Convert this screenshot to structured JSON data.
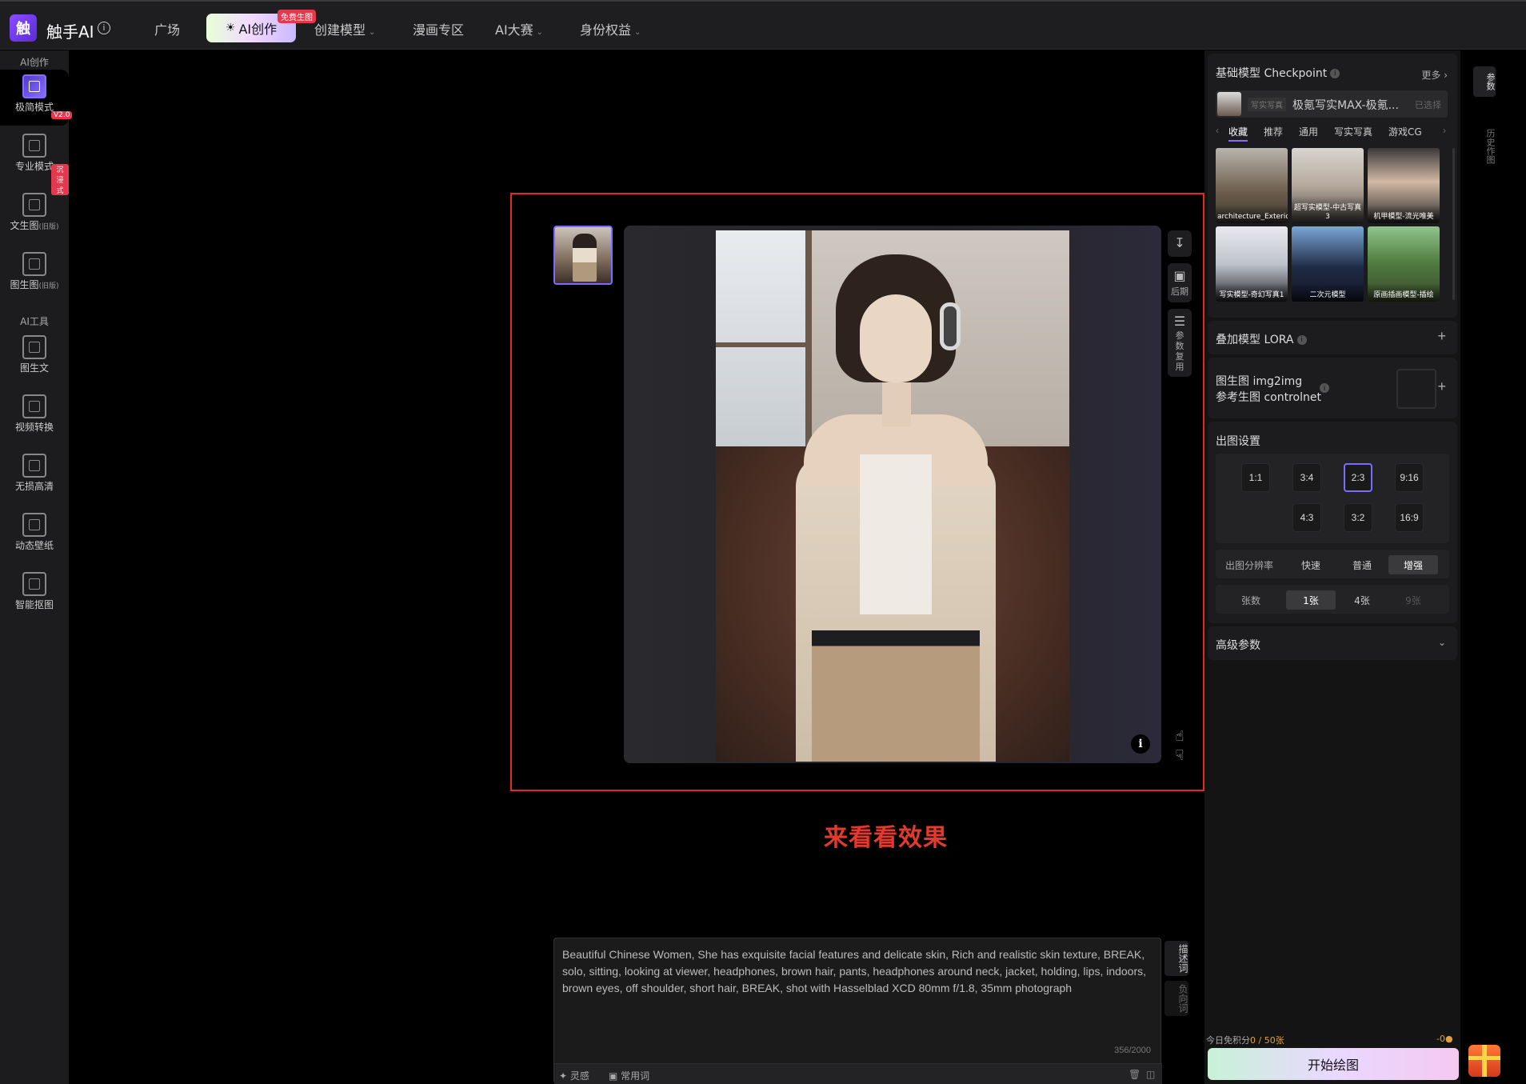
{
  "topbar": {
    "logo_text": "触",
    "app_title": "触手AI",
    "nav": [
      {
        "label": "广场"
      },
      {
        "label": "AI创作",
        "badge": "免费生图"
      },
      {
        "label": "创建模型"
      },
      {
        "label": "漫画专区"
      },
      {
        "label": "AI大赛"
      },
      {
        "label": "身份权益"
      }
    ],
    "active_icon": "bulb-icon"
  },
  "sidebar": {
    "section_create": "AI创作",
    "section_tools": "AI工具",
    "items": [
      {
        "label": "极简模式",
        "badge": "V2.0",
        "icon": "magic-wand-icon"
      },
      {
        "label": "专业模式",
        "badge": "沉浸式",
        "icon": "cursor-canvas-icon"
      },
      {
        "label": "文生图",
        "suffix": "(旧版)",
        "icon": "text-to-image-icon"
      },
      {
        "label": "图生图",
        "suffix": "(旧版)",
        "icon": "image-to-image-icon"
      },
      {
        "label": "图生文",
        "icon": "image-to-text-icon"
      },
      {
        "label": "视频转换",
        "icon": "video-convert-icon"
      },
      {
        "label": "无损高清",
        "icon": "hd-upscale-icon"
      },
      {
        "label": "动态壁纸",
        "icon": "live-wallpaper-icon"
      },
      {
        "label": "智能抠图",
        "icon": "smart-cutout-icon"
      }
    ]
  },
  "viewer": {
    "tools": [
      {
        "label": "",
        "icon": "download-icon"
      },
      {
        "label": "后期",
        "icon": "edit-image-icon"
      },
      {
        "label": "参数复用",
        "icon": "sliders-icon"
      }
    ],
    "info_glyph": "i",
    "caption": "来看看效果"
  },
  "prompt": {
    "text": "Beautiful Chinese Women,  She has exquisite facial features and delicate skin,  Rich and realistic skin texture,  BREAK,  solo,  sitting,  looking at viewer,  headphones,  brown hair,  pants,  headphones around neck,  jacket,  holding,  lips,  indoors,  brown eyes,  off shoulder,  short hair,  BREAK,  shot with Hasselblad XCD 80mm f/1.8,  35mm photograph",
    "count": "356/2000",
    "foot_inspire": "灵感",
    "foot_common": "常用词",
    "tab_positive": "描述词",
    "tab_negative": "负向词"
  },
  "rpanel": {
    "checkpoint_title": "基础模型 Checkpoint",
    "more": "更多",
    "selected_tag": "写实写真",
    "selected_name": "极氪写实MAX-极氪...",
    "selected_state": "已选择",
    "model_tabs": [
      "收藏",
      "推荐",
      "通用",
      "写实写真",
      "游戏CG"
    ],
    "models": [
      {
        "label": "architecture_Exterior"
      },
      {
        "label": "超写实模型-中古写真3"
      },
      {
        "label": "机甲模型-流光唯美"
      },
      {
        "label": "写实模型-奇幻写真1"
      },
      {
        "label": "二次元模型"
      },
      {
        "label": "原画插画模型-插绘"
      }
    ],
    "lora_title": "叠加模型 LORA",
    "img2img_line1": "图生图 img2img",
    "img2img_line2": "参考生图 controlnet",
    "output_title": "出图设置",
    "ratios": [
      "1:1",
      "3:4",
      "2:3",
      "9:16",
      "4:3",
      "3:2",
      "16:9"
    ],
    "selected_ratio": "2:3",
    "resolution_label": "出图分辨率",
    "resolution_opts": [
      "快速",
      "普通",
      "增强"
    ],
    "resolution_selected": "增强",
    "count_label": "张数",
    "count_opts": [
      "1张",
      "4张",
      "9张"
    ],
    "count_selected": "1张",
    "advanced_title": "高级参数",
    "credits_prefix": "今日免积分",
    "credits_value": "0 / 50张",
    "credits_right": "-0",
    "start_button": "开始绘图",
    "side_tabs": [
      "参数",
      "历史作图"
    ]
  }
}
